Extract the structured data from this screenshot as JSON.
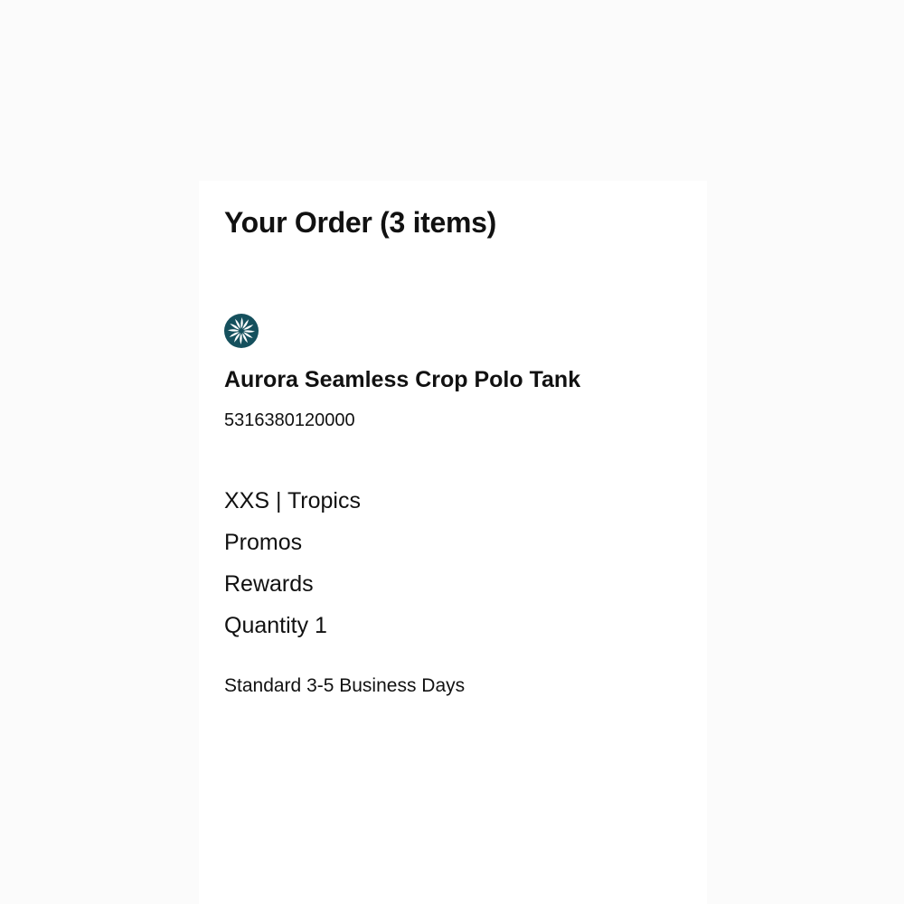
{
  "order": {
    "title": "Your Order (3 items)"
  },
  "brand": {
    "logo_icon": "pinwheel-logo-icon",
    "logo_color": "#15505d"
  },
  "item": {
    "name": "Aurora Seamless Crop Polo Tank",
    "sku": "5316380120000",
    "variant": "XXS | Tropics",
    "promos_label": "Promos",
    "rewards_label": "Rewards",
    "quantity_text": "Quantity 1",
    "shipping_method": "Standard 3-5 Business Days"
  }
}
